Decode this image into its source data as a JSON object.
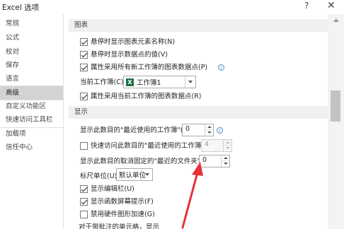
{
  "window": {
    "title": "Excel 选项",
    "help_label": "?",
    "close_label": "✕"
  },
  "sidebar": {
    "items": [
      {
        "label": "常规"
      },
      {
        "label": "公式"
      },
      {
        "label": "校对"
      },
      {
        "label": "保存"
      },
      {
        "label": "语言"
      },
      {
        "label": "高级",
        "selected": true
      },
      {
        "label": "自定义功能区"
      },
      {
        "label": "快速访问工具栏"
      },
      {
        "label": "加载项"
      },
      {
        "label": "信任中心"
      }
    ]
  },
  "chart_section": {
    "header": "图表",
    "options": [
      {
        "label": "悬停时显示图表元素名称(N)",
        "checked": true
      },
      {
        "label": "悬停时显示数据点的值(V)",
        "checked": true
      },
      {
        "label": "属性采用所有新工作簿的图表数据点(P)",
        "checked": true,
        "info_icon": "info-icon"
      }
    ],
    "current_workbook_label": "当前工作簿(C):",
    "current_workbook_value": "工作簿1",
    "workbook_icon": "excel-workbook-icon",
    "current_option": {
      "label": "属性采用当前工作簿的图表数据点(R)",
      "checked": true
    }
  },
  "display_section": {
    "header": "显示",
    "recent_workbooks_label": "显示此数目的\"最近使用的工作簿\"(R):",
    "recent_workbooks_value": "0",
    "quick_access_label": "快速访问此数目的\"最近使用的工作簿\"(Q):",
    "quick_access_checked": false,
    "quick_access_value": "4",
    "unpinned_folders_label": "显示此数目的取消固定的\"最近的文件夹\"(F):",
    "unpinned_folders_value": "0",
    "ruler_units_label": "标尺单位(U)",
    "ruler_units_value": "默认单位",
    "options": [
      {
        "label": "显示编辑栏(U)",
        "checked": true
      },
      {
        "label": "显示函数屏幕提示(F)",
        "checked": true
      },
      {
        "label": "禁用硬件图形加速(G)",
        "checked": false
      }
    ],
    "footer_text": "对于带批注的单元格，显示"
  },
  "annotation": {
    "color": "#e8313a"
  }
}
